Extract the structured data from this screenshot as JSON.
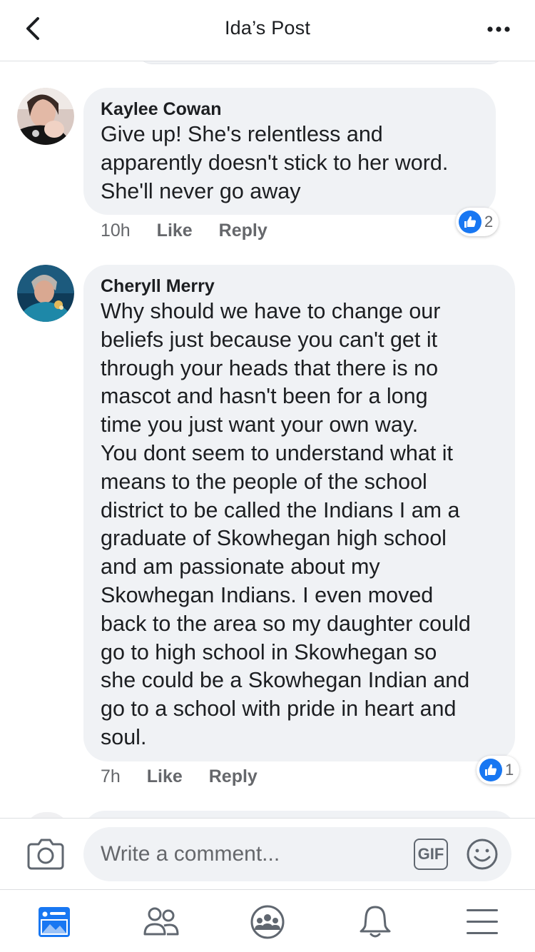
{
  "header": {
    "title": "Ida’s Post",
    "back_icon": "chevron-left-icon",
    "more_icon": "more-horizontal-icon"
  },
  "comments": [
    {
      "author": "Kaylee Cowan",
      "text": "Give up! She's relentless and\napparently doesn't stick to her word.\nShe'll never go away",
      "time": "10h",
      "like_label": "Like",
      "reply_label": "Reply",
      "reaction_count": "2"
    },
    {
      "author": "Cheryll Merry",
      "text": "Why should we have to change our\nbeliefs just because you can't get it\nthrough your heads that there is no\nmascot and hasn't been for a long\ntime you just want your own way.\nYou dont seem to understand what it\nmeans to the people of the school\ndistrict to be called the Indians  I am a\ngraduate of Skowhegan high school\nand am passionate about my\nSkowhegan Indians. I even moved\nback to the area so my daughter could\ngo to high school in Skowhegan so\nshe could be a  Skowhegan Indian and\ngo to a school with pride in  heart and\nsoul.",
      "time": "7h",
      "like_label": "Like",
      "reply_label": "Reply",
      "reaction_count": "1"
    }
  ],
  "composer": {
    "placeholder": "Write a comment...",
    "gif_label": "GIF",
    "camera_icon": "camera-icon",
    "emoji_icon": "smiley-icon"
  },
  "tabs": [
    {
      "name": "news-feed",
      "icon": "news-feed-icon",
      "active": true
    },
    {
      "name": "friends",
      "icon": "friends-icon",
      "active": false
    },
    {
      "name": "groups",
      "icon": "groups-icon",
      "active": false
    },
    {
      "name": "notifications",
      "icon": "bell-icon",
      "active": false
    },
    {
      "name": "menu",
      "icon": "menu-icon",
      "active": false
    }
  ],
  "colors": {
    "accent": "#1877f2",
    "bubble": "#f0f2f5",
    "text": "#1c1e21",
    "secondary_text": "#65676b",
    "icon_gray": "#606770"
  }
}
